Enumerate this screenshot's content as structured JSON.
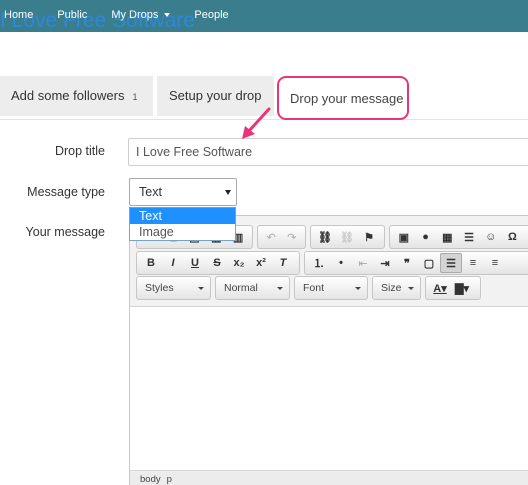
{
  "nav": {
    "items": [
      "Home",
      "Public",
      "My Drops",
      "People"
    ]
  },
  "site": {
    "title": "I Love Free Software"
  },
  "tabs": [
    {
      "label": "Add some followers",
      "badge": "1"
    },
    {
      "label": "Setup your drop"
    },
    {
      "label": "Drop your message"
    }
  ],
  "form": {
    "drop_title_label": "Drop title",
    "drop_title_value": "I Love Free Software",
    "message_type_label": "Message type",
    "message_type_selected": "Text",
    "message_type_options": [
      "Text",
      "Image"
    ],
    "your_message_label": "Your message"
  },
  "editor": {
    "styles_label": "Styles",
    "format_label": "Normal",
    "font_label": "Font",
    "size_label": "Size",
    "status_path": [
      "body",
      "p"
    ]
  },
  "colors": {
    "topbar": "#3a7d8c",
    "title_blue": "#2e88d6",
    "highlight_pink": "#e8357a",
    "select_blue": "#1e90ff"
  }
}
